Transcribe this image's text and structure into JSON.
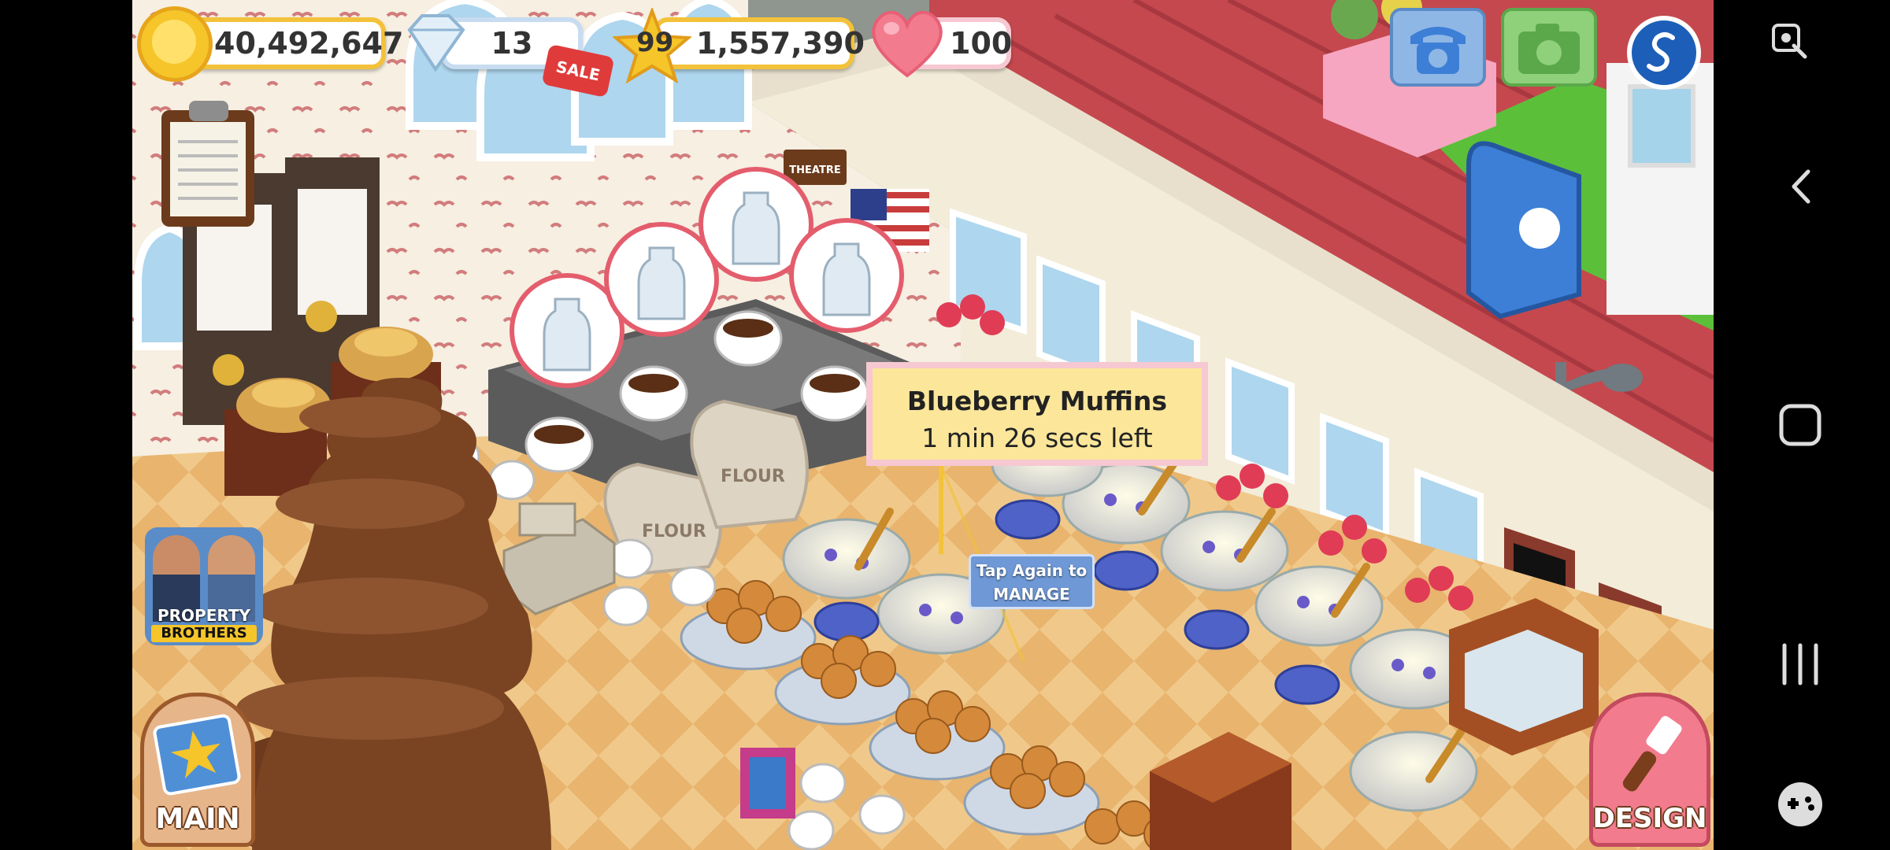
{
  "hud": {
    "coins": "40,492,647",
    "gems": "13",
    "sale_badge": "SALE",
    "level": "99",
    "xp": "1,557,390",
    "hearts": "100"
  },
  "tooltip": {
    "title": "Blueberry Muffins",
    "time_left": "1 min 26 secs left"
  },
  "tap_hint": {
    "line1": "Tap Again to",
    "line2": "MANAGE"
  },
  "buttons": {
    "main": "MAIN",
    "design": "DESIGN"
  },
  "promo": {
    "line1": "PROPERTY",
    "line2": "BROTHERS"
  },
  "signs": {
    "theatre": "THEATRE",
    "flour": "FLOUR"
  },
  "icons": {
    "top_right": [
      "phone-icon",
      "camera-icon",
      "social-icon"
    ],
    "system_nav": [
      "screen-lock-icon",
      "back-icon",
      "home-icon",
      "recent-apps-icon",
      "game-launcher-icon"
    ]
  },
  "colors": {
    "coin_gold": "#f5c52a",
    "pill_border": "#f3c23a",
    "tooltip_bg": "#fbe69a",
    "tooltip_border": "#f6c8d2",
    "tap_bg": "#6f98d6",
    "roof_red": "#c4484e"
  }
}
